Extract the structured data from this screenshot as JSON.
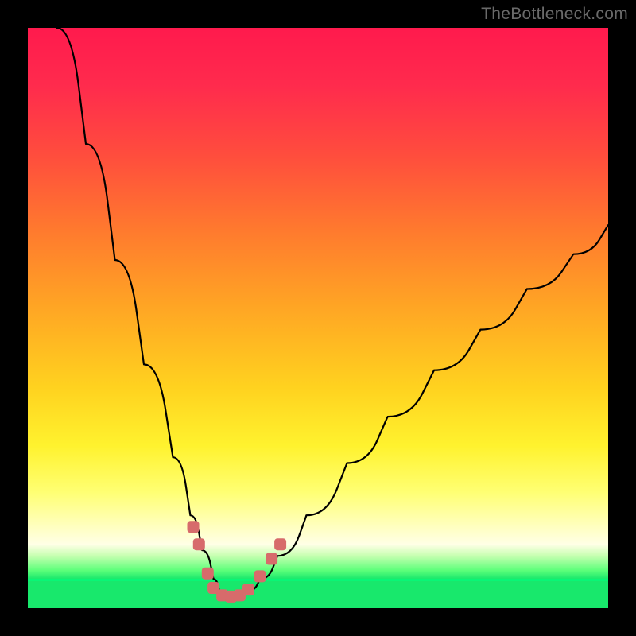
{
  "watermark": "TheBottleneck.com",
  "chart_data": {
    "type": "line",
    "title": "",
    "xlabel": "",
    "ylabel": "",
    "xlim": [
      0,
      100
    ],
    "ylim": [
      0,
      100
    ],
    "grid": false,
    "series": [
      {
        "name": "bottleneck-curve",
        "x": [
          5,
          10,
          15,
          20,
          25,
          28,
          30,
          32,
          33,
          34,
          35,
          36,
          38,
          40,
          43,
          48,
          55,
          62,
          70,
          78,
          86,
          94,
          100
        ],
        "y": [
          100,
          80,
          60,
          42,
          26,
          16,
          10,
          5,
          3,
          2,
          2,
          2,
          3,
          5,
          9,
          16,
          25,
          33,
          41,
          48,
          55,
          61,
          66
        ]
      }
    ],
    "points": [
      {
        "x": 28.5,
        "y": 14
      },
      {
        "x": 29.5,
        "y": 11
      },
      {
        "x": 31.0,
        "y": 6
      },
      {
        "x": 32.0,
        "y": 3.5
      },
      {
        "x": 33.5,
        "y": 2.2
      },
      {
        "x": 35.0,
        "y": 2.0
      },
      {
        "x": 36.5,
        "y": 2.2
      },
      {
        "x": 38.0,
        "y": 3.2
      },
      {
        "x": 40.0,
        "y": 5.5
      },
      {
        "x": 42.0,
        "y": 8.5
      },
      {
        "x": 43.5,
        "y": 11
      }
    ],
    "colors": {
      "gradient_top": "#ff1a4d",
      "gradient_mid": "#ffd21f",
      "gradient_bottom": "#18e86c",
      "curve": "#000000",
      "points": "#d76b6b"
    }
  }
}
